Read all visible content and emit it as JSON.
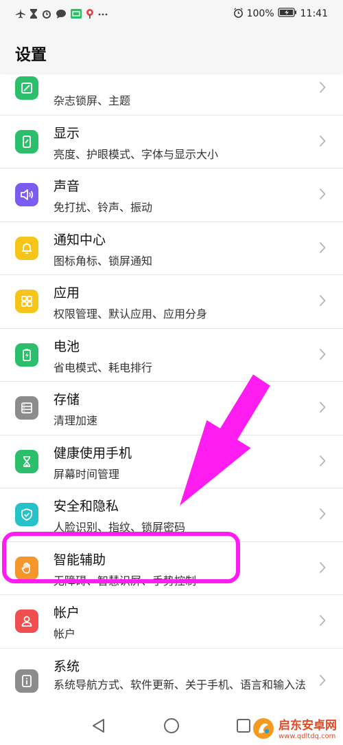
{
  "status_bar": {
    "battery": "100%",
    "time": "11:41",
    "left_icons": [
      "airplane-icon",
      "hourglass-icon",
      "alarm-icon",
      "message-icon",
      "app-icon",
      "location-icon",
      "more-icon"
    ]
  },
  "header": {
    "title": "设置"
  },
  "settings": {
    "items": [
      {
        "title": "",
        "subtitle": "杂志锁屏、主题",
        "icon": "theme-icon",
        "color": "#2cbf6b"
      },
      {
        "title": "显示",
        "subtitle": "亮度、护眼模式、字体与显示大小",
        "icon": "display-icon",
        "color": "#2cbf6b"
      },
      {
        "title": "声音",
        "subtitle": "免打扰、铃声、振动",
        "icon": "sound-icon",
        "color": "#7a5cf0"
      },
      {
        "title": "通知中心",
        "subtitle": "图标角标、锁屏通知",
        "icon": "bell-icon",
        "color": "#f7c51a"
      },
      {
        "title": "应用",
        "subtitle": "权限管理、默认应用、应用分身",
        "icon": "apps-icon",
        "color": "#f7c51a"
      },
      {
        "title": "电池",
        "subtitle": "省电模式、耗电排行",
        "icon": "battery-icon",
        "color": "#2cbf6b"
      },
      {
        "title": "存储",
        "subtitle": "清理加速",
        "icon": "storage-icon",
        "color": "#8c8c8c"
      },
      {
        "title": "健康使用手机",
        "subtitle": "屏幕时间管理",
        "icon": "hourglass-icon",
        "color": "#2cbf6b"
      },
      {
        "title": "安全和隐私",
        "subtitle": "人脸识别、指纹、锁屏密码",
        "icon": "shield-icon",
        "color": "#25c3c9"
      },
      {
        "title": "智能辅助",
        "subtitle": "无障碍、智慧识屏、手势控制",
        "icon": "hand-icon",
        "color": "#f5962d"
      },
      {
        "title": "帐户",
        "subtitle": "帐户",
        "icon": "user-icon",
        "color": "#ef4f4f"
      },
      {
        "title": "系统",
        "subtitle": "系统导航方式、软件更新、关于手机、语言和输入法",
        "icon": "system-icon",
        "color": "#8c8c8c"
      }
    ]
  },
  "watermark": {
    "brand": "启东安卓网",
    "url": "www.qdltdq.com"
  },
  "colors": {
    "highlight": "#ff1cf0",
    "chevron": "#b5b5b5"
  }
}
